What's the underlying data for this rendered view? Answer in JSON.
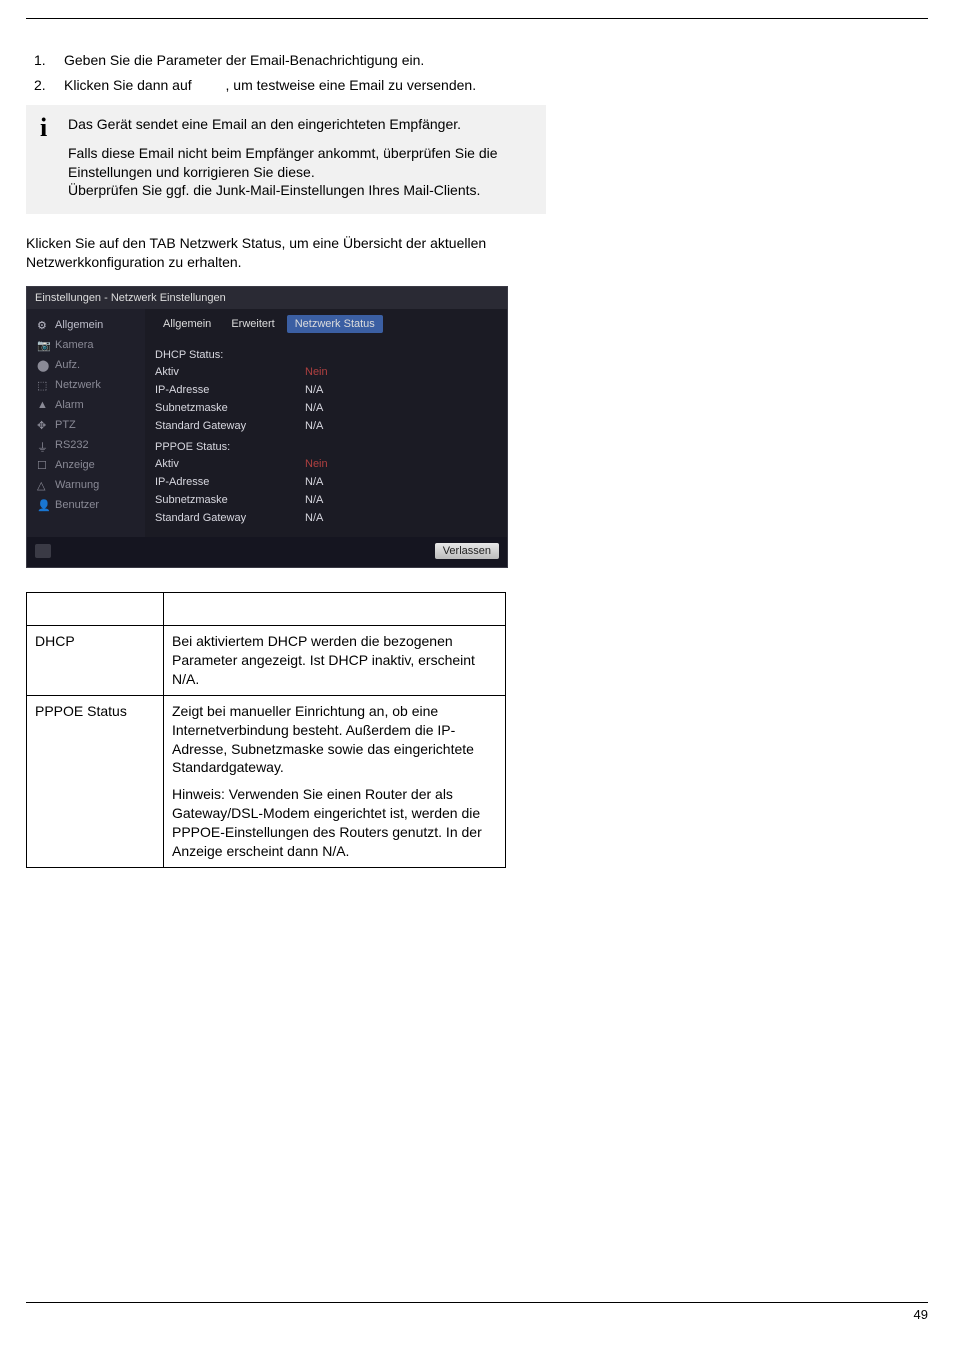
{
  "steps": [
    {
      "num": "1.",
      "text": "Geben Sie die Parameter der Email-Benachrichtigung ein."
    },
    {
      "num": "2.",
      "text_a": "Klicken Sie dann auf ",
      "text_b": ", um testweise eine Email zu versenden."
    }
  ],
  "info": {
    "p1": "Das Gerät sendet eine Email an den eingerichteten Empfänger.",
    "p2": "Falls diese Email nicht beim Empfänger ankommt, überprüfen Sie die Einstellungen und korrigieren Sie diese.",
    "p3": "Überprüfen Sie ggf. die Junk-Mail-Einstellungen Ihres Mail-Clients."
  },
  "para": "Klicken Sie auf den TAB Netzwerk Status, um eine Übersicht der aktuellen Netzwerkkonfiguration zu erhalten.",
  "screenshot": {
    "title": "Einstellungen - Netzwerk Einstellungen",
    "sidebar": [
      "Allgemein",
      "Kamera",
      "Aufz.",
      "Netzwerk",
      "Alarm",
      "PTZ",
      "RS232",
      "Anzeige",
      "Warnung",
      "Benutzer"
    ],
    "tabs": {
      "t1": "Allgemein",
      "t2": "Erweitert",
      "t3": "Netzwerk Status"
    },
    "dhcp_head": "DHCP Status:",
    "pppoe_head": "PPPOE Status:",
    "rows": {
      "aktiv": "Aktiv",
      "nein": "Nein",
      "ip": "IP-Adresse",
      "na": "N/A",
      "sub": "Subnetzmaske",
      "gw": "Standard Gateway"
    },
    "verlassen": "Verlassen"
  },
  "table": {
    "r1": {
      "c1": "DHCP",
      "c2": "Bei aktiviertem DHCP werden die bezogenen Parameter angezeigt. Ist DHCP inaktiv, erscheint N/A."
    },
    "r2": {
      "c1": "PPPOE Status",
      "c2a": "Zeigt bei manueller Einrichtung an, ob eine Internetverbindung besteht. Außerdem die IP-Adresse, Subnetzmaske sowie das eingerichtete Standardgateway.",
      "c2b": "Hinweis: Verwenden Sie einen Router der als Gateway/DSL-Modem eingerichtet ist, werden die PPPOE-Einstellungen des Routers genutzt. In der Anzeige erscheint dann N/A."
    }
  },
  "page_number": "49"
}
